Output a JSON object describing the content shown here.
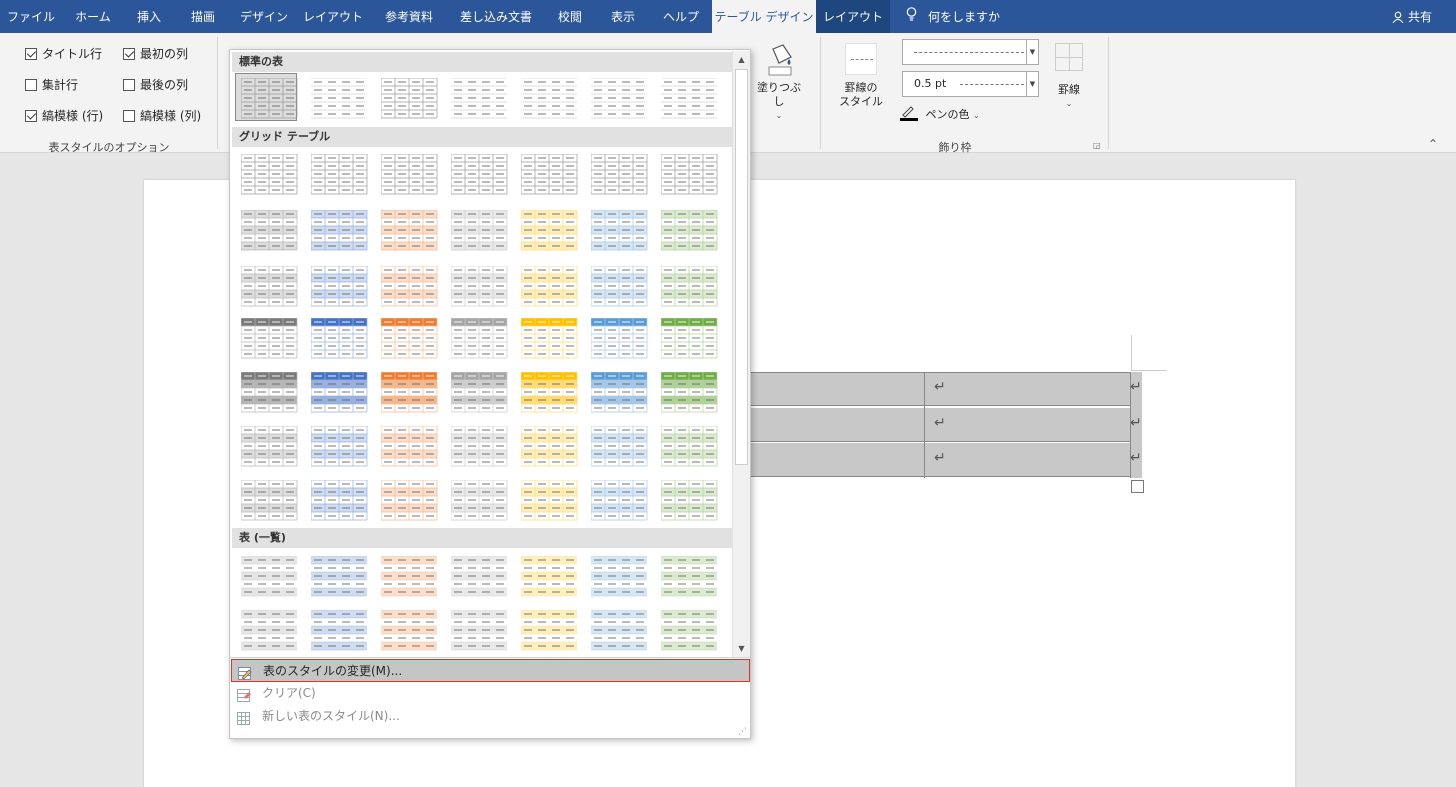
{
  "tabs": [
    {
      "label": "ファイル"
    },
    {
      "label": "ホーム"
    },
    {
      "label": "挿入"
    },
    {
      "label": "描画"
    },
    {
      "label": "デザイン"
    },
    {
      "label": "レイアウト"
    },
    {
      "label": "参考資料"
    },
    {
      "label": "差し込み文書"
    },
    {
      "label": "校閲"
    },
    {
      "label": "表示"
    },
    {
      "label": "ヘルプ"
    },
    {
      "label": "テーブル デザイン"
    },
    {
      "label": "レイアウト"
    },
    {
      "label": "何をしますか"
    }
  ],
  "active_tab": "テーブル デザイン",
  "share_label": "共有",
  "style_options": {
    "items": [
      {
        "label": "タイトル行",
        "checked": true
      },
      {
        "label": "最初の列",
        "checked": true
      },
      {
        "label": "集計行",
        "checked": false
      },
      {
        "label": "最後の列",
        "checked": false
      },
      {
        "label": "縞模様 (行)",
        "checked": true
      },
      {
        "label": "縞模様 (列)",
        "checked": false
      }
    ],
    "group_label": "表スタイルのオプション"
  },
  "shading": {
    "label": "塗りつぶし"
  },
  "borders": {
    "border_style_label": "罫線の\nスタイル",
    "line_style_value": "",
    "weight_value": "0.5 pt",
    "pen_color_label": "ペンの色",
    "borders_label": "罫線",
    "group_label": "飾り枠"
  },
  "gallery": {
    "sections": [
      {
        "title": "標準の表"
      },
      {
        "title": "グリッド テーブル"
      },
      {
        "title": "表 (一覧)"
      }
    ],
    "accent_colors": [
      "#000000",
      "#4472c4",
      "#ed7d31",
      "#a5a5a5",
      "#ffc000",
      "#5b9bd5",
      "#70ad47"
    ],
    "menu": [
      {
        "label": "表のスタイルの変更(M)...",
        "highlighted": true
      },
      {
        "label": "クリア(C)",
        "enabled": false
      },
      {
        "label": "新しい表のスタイル(N)...",
        "enabled": false
      }
    ]
  },
  "document": {
    "return_mark": "↵"
  }
}
